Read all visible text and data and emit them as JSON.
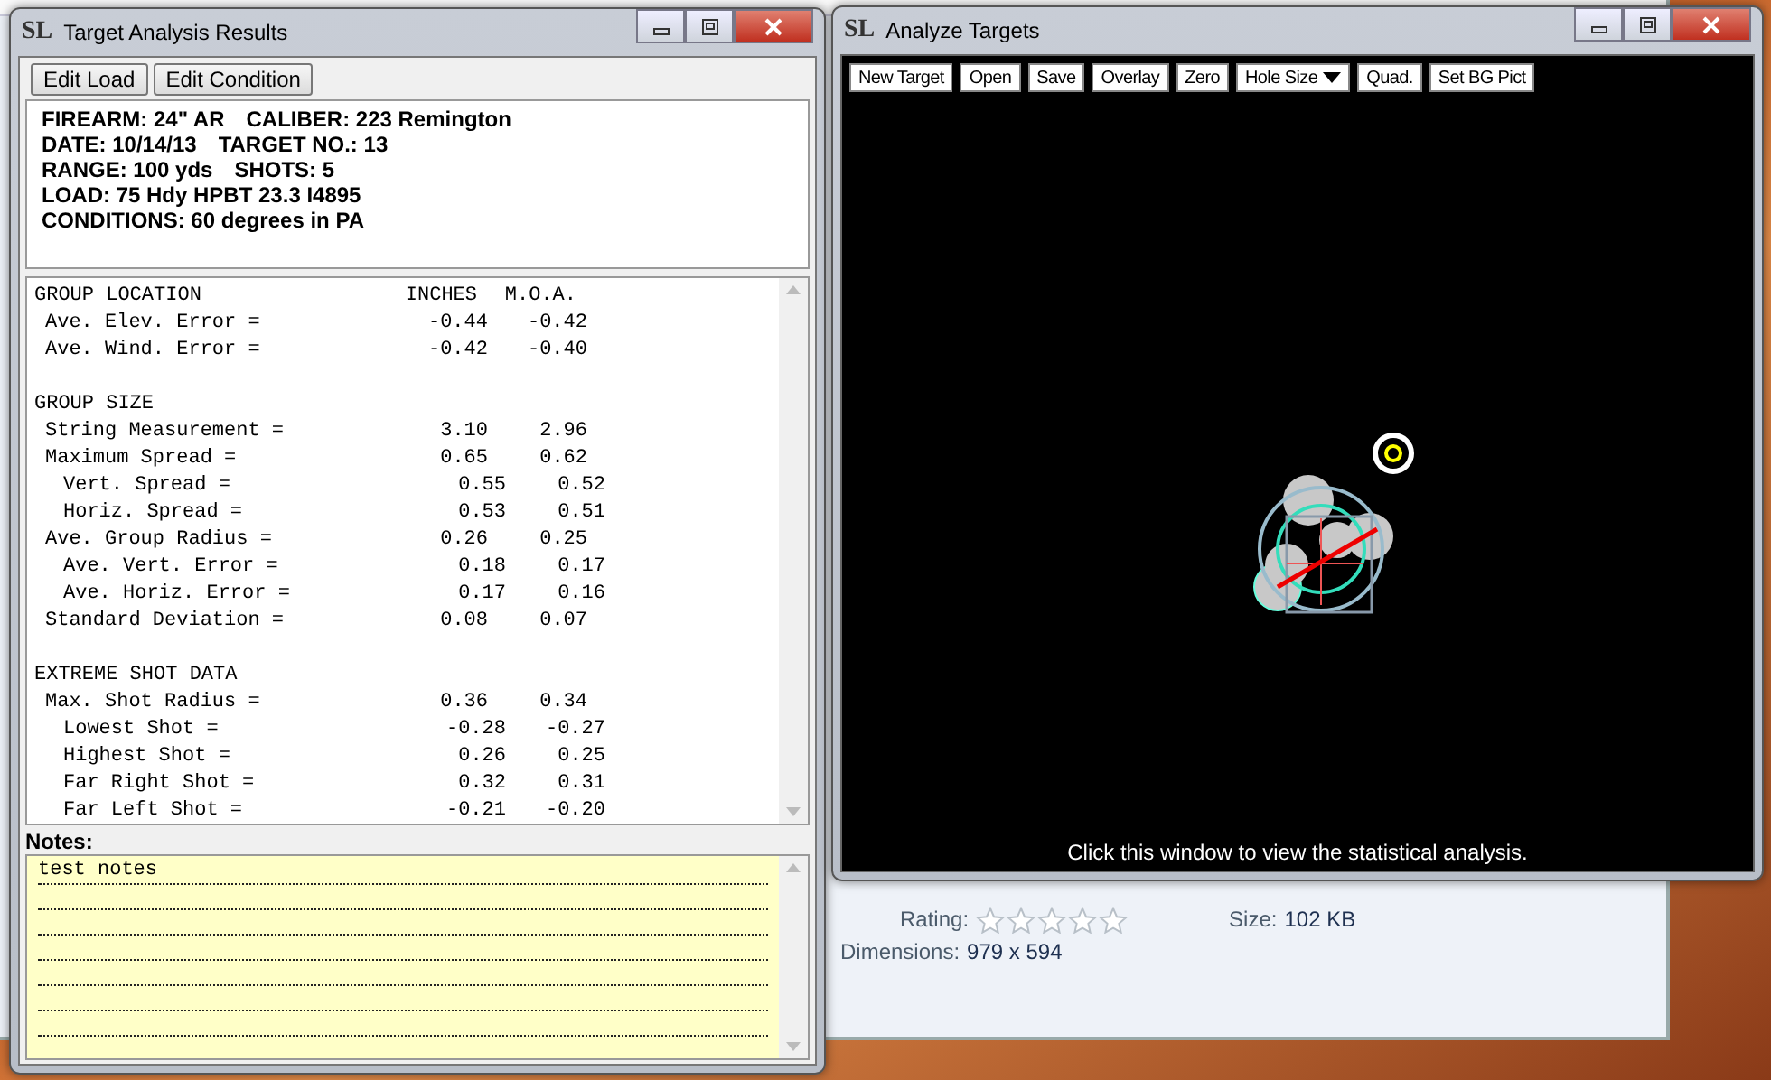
{
  "background_window": {
    "details": {
      "rating_label": "Rating:",
      "stars": 0,
      "size_label": "Size:",
      "size": "102 KB",
      "dimensions_label": "Dimensions:",
      "dimensions": "979 x 594"
    }
  },
  "results_window": {
    "logo": "SL",
    "title": "Target Analysis Results",
    "buttons": [
      "Edit Load",
      "Edit Condition"
    ],
    "info_lines": [
      [
        "FIREARM: 24\" AR",
        "CALIBER: 223 Remington"
      ],
      [
        "DATE: 10/14/13",
        "TARGET NO.: 13"
      ],
      [
        "RANGE: 100 yds",
        "SHOTS: 5"
      ],
      [
        "LOAD: 75 Hdy HPBT 23.3 I4895"
      ],
      [
        "CONDITIONS: 60 degrees in PA"
      ]
    ],
    "stat_columns": [
      "INCHES",
      "M.O.A."
    ],
    "sections": [
      {
        "title": "GROUP LOCATION",
        "rows": [
          {
            "label": "Ave. Elev. Error =",
            "inches": "-0.44",
            "moa": "-0.42"
          },
          {
            "label": "Ave. Wind. Error =",
            "inches": "-0.42",
            "moa": "-0.40"
          }
        ]
      },
      {
        "title": "GROUP SIZE",
        "rows": [
          {
            "label": "String Measurement =",
            "inches": "3.10",
            "moa": "2.96"
          },
          {
            "label": "Maximum Spread =",
            "inches": "0.65",
            "moa": "0.62",
            "children": [
              {
                "label": "Vert. Spread =",
                "inches": "0.55",
                "moa": "0.52"
              },
              {
                "label": "Horiz. Spread =",
                "inches": "0.53",
                "moa": "0.51"
              }
            ]
          },
          {
            "label": "Ave. Group Radius =",
            "inches": "0.26",
            "moa": "0.25",
            "children": [
              {
                "label": "Ave. Vert. Error =",
                "inches": "0.18",
                "moa": "0.17"
              },
              {
                "label": "Ave. Horiz. Error =",
                "inches": "0.17",
                "moa": "0.16"
              }
            ]
          },
          {
            "label": "Standard Deviation =",
            "inches": "0.08",
            "moa": "0.07"
          }
        ]
      },
      {
        "title": "EXTREME SHOT DATA",
        "rows": [
          {
            "label": "Max. Shot Radius =",
            "inches": "0.36",
            "moa": "0.34",
            "children": [
              {
                "label": "Lowest Shot =",
                "inches": "-0.28",
                "moa": "-0.27"
              },
              {
                "label": "Highest Shot =",
                "inches": "0.26",
                "moa": "0.25"
              },
              {
                "label": "Far Right Shot =",
                "inches": "0.32",
                "moa": "0.31"
              },
              {
                "label": "Far Left Shot =",
                "inches": "-0.21",
                "moa": "-0.20"
              }
            ]
          }
        ]
      }
    ],
    "notes_label": "Notes:",
    "notes": "test notes"
  },
  "analyze_window": {
    "logo": "SL",
    "title": "Analyze Targets",
    "toolbar": [
      {
        "label": "New Target",
        "kind": "button"
      },
      {
        "label": "Open",
        "kind": "button"
      },
      {
        "label": "Save",
        "kind": "button"
      },
      {
        "label": "Overlay",
        "kind": "button"
      },
      {
        "label": "Zero",
        "kind": "button"
      },
      {
        "label": "Hole Size",
        "kind": "dropdown"
      },
      {
        "label": "Quad.",
        "kind": "button"
      },
      {
        "label": "Set BG Pict",
        "kind": "button"
      }
    ],
    "hint": "Click this window to view the statistical analysis."
  }
}
